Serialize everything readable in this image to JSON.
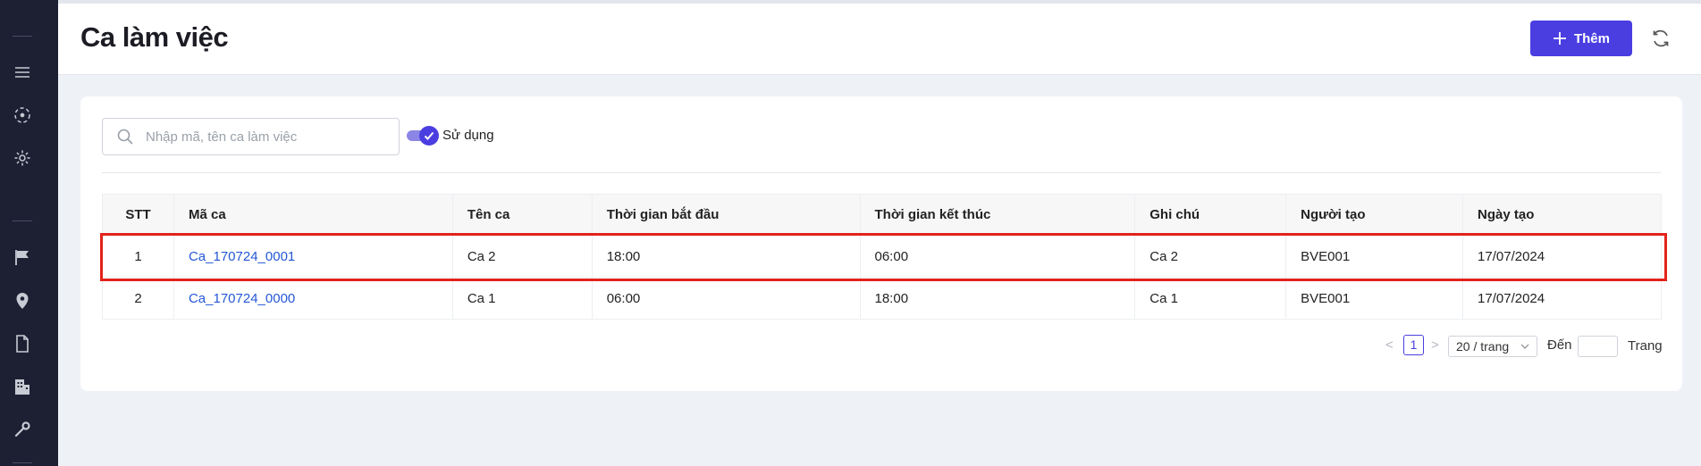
{
  "header": {
    "title": "Ca làm việc",
    "add_label": "Thêm"
  },
  "filters": {
    "search_placeholder": "Nhập mã, tên ca làm việc",
    "toggle_label": "Sử dụng",
    "toggle_on": true
  },
  "table": {
    "headers": [
      "STT",
      "Mã ca",
      "Tên ca",
      "Thời gian bắt đầu",
      "Thời gian kết thúc",
      "Ghi chú",
      "Người tạo",
      "Ngày tạo"
    ],
    "rows": [
      {
        "stt": "1",
        "code": "Ca_170724_0001",
        "name": "Ca 2",
        "start": "18:00",
        "end": "06:00",
        "note": "Ca 2",
        "creator": "BVE001",
        "created": "17/07/2024"
      },
      {
        "stt": "2",
        "code": "Ca_170724_0000",
        "name": "Ca 1",
        "start": "06:00",
        "end": "18:00",
        "note": "Ca 1",
        "creator": "BVE001",
        "created": "17/07/2024"
      }
    ]
  },
  "pagination": {
    "prev": "<",
    "current_page": "1",
    "next": ">",
    "page_size": "20 / trang",
    "goto_label": "Đến",
    "page_label": "Trang"
  },
  "colors": {
    "accent": "#4a3ee0",
    "sidebar": "#1d2033",
    "link": "#2457d6",
    "highlight": "#e2231a"
  }
}
